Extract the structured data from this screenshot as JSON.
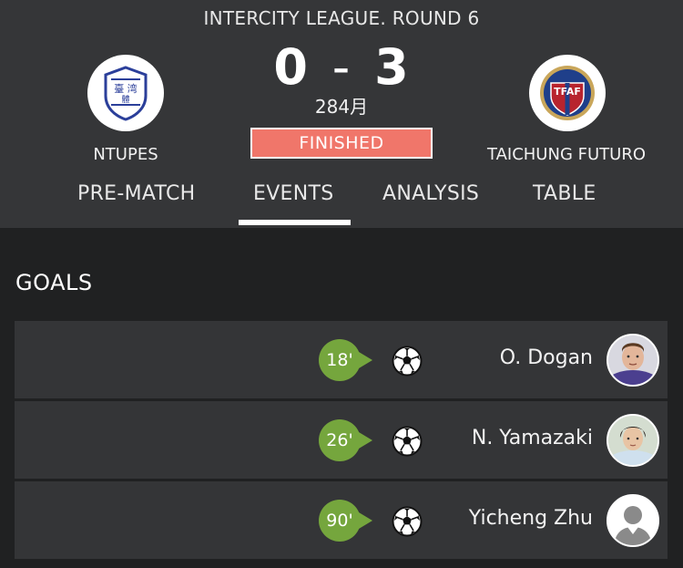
{
  "match": {
    "league": "INTERCITY LEAGUE. ROUND 6",
    "home_team": "NTUPES",
    "away_team": "TAICHUNG FUTURO",
    "home_score": "0",
    "separator": "-",
    "away_score": "3",
    "attendance": "284月",
    "status": "FINISHED",
    "status_color": "#f0766a",
    "away_crest_text": "TFAF",
    "home_crest_text": "臺灣體大"
  },
  "tabs": [
    {
      "label": "PRE-MATCH",
      "active": false
    },
    {
      "label": "EVENTS",
      "active": true
    },
    {
      "label": "ANALYSIS",
      "active": false
    },
    {
      "label": "TABLE",
      "active": false
    }
  ],
  "goals": {
    "title": "GOALS",
    "accent": "#75a63d",
    "items": [
      {
        "minute": "18'",
        "player": "O. Dogan",
        "icon": "soccer-ball-icon"
      },
      {
        "minute": "26'",
        "player": "N. Yamazaki",
        "icon": "soccer-ball-icon"
      },
      {
        "minute": "90'",
        "player": "Yicheng Zhu",
        "icon": "soccer-ball-icon"
      }
    ]
  }
}
